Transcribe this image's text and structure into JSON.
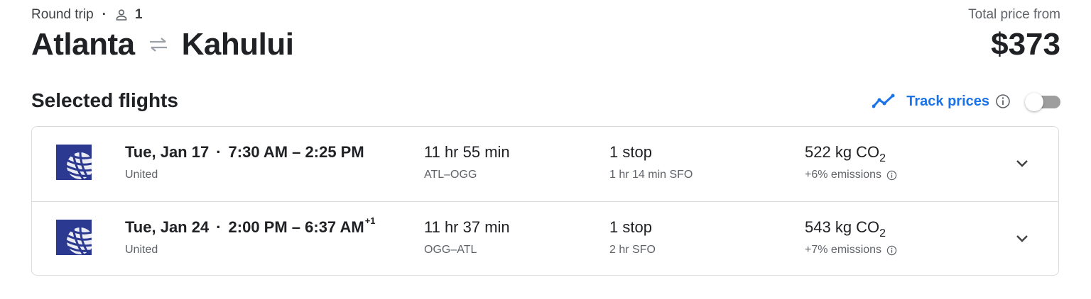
{
  "header": {
    "trip_type": "Round trip",
    "passenger_count": "1",
    "origin": "Atlanta",
    "destination": "Kahului",
    "price_label": "Total price from",
    "price": "$373"
  },
  "section": {
    "title": "Selected flights",
    "track_label": "Track prices",
    "track_enabled": false
  },
  "flights": [
    {
      "date": "Tue, Jan 17",
      "time_range": "7:30 AM – 2:25 PM",
      "day_offset": "",
      "airline": "United",
      "duration": "11 hr 55 min",
      "route": "ATL–OGG",
      "stops": "1 stop",
      "layover": "1 hr 14 min SFO",
      "emissions_value": "522 kg CO",
      "emissions_sub": "2",
      "emissions_delta": "+6% emissions"
    },
    {
      "date": "Tue, Jan 24",
      "time_range": "2:00 PM – 6:37 AM",
      "day_offset": "+1",
      "airline": "United",
      "duration": "11 hr 37 min",
      "route": "OGG–ATL",
      "stops": "1 stop",
      "layover": "2 hr SFO",
      "emissions_value": "543 kg CO",
      "emissions_sub": "2",
      "emissions_delta": "+7% emissions"
    }
  ],
  "icons": {
    "person": "person-icon",
    "swap": "swap-arrows-icon",
    "trend": "trend-line-icon",
    "info": "info-icon",
    "chevron": "chevron-down-icon",
    "airline_logo": "united-globe-logo"
  },
  "colors": {
    "accent": "#1a73e8",
    "logo_blue": "#2b3990"
  }
}
